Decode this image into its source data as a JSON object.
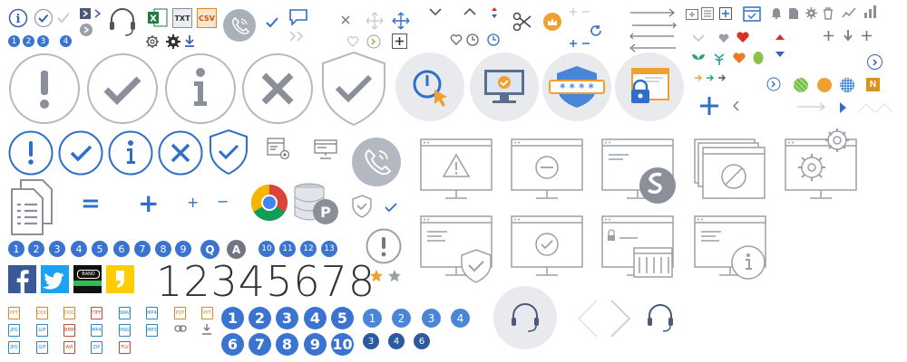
{
  "colors": {
    "blue": "#2f6fc9",
    "blue_dark": "#3a5fb0",
    "gray": "#9aa0aa",
    "gray_light": "#c6cbd3",
    "orange": "#f0a030",
    "red": "#d93025",
    "green": "#2aa46a"
  },
  "small_badges": [
    "1",
    "2",
    "3",
    "4"
  ],
  "number_badges": [
    "1",
    "2",
    "3",
    "4",
    "5",
    "6",
    "7",
    "8",
    "9"
  ],
  "letter_badges": [
    "Q",
    "A"
  ],
  "number_badges_2": [
    "10",
    "11",
    "12",
    "13"
  ],
  "big_digits": "12345678",
  "blue_large_row1": [
    "1",
    "2",
    "3",
    "4",
    "5"
  ],
  "blue_large_row2": [
    "6",
    "7",
    "8",
    "9",
    "10"
  ],
  "blue_small_row1": [
    "1",
    "2",
    "3",
    "4"
  ],
  "blue_small_row2": [
    "3",
    "4",
    "6"
  ],
  "file_labels": [
    "PPT",
    "DOC",
    "DOC",
    "TIFF",
    "WAV",
    "MP4",
    "PDF",
    "PPT",
    "JPG",
    "GIF",
    "BMP",
    "MP4",
    "PNG",
    "MP3",
    "JPG",
    "GIF",
    "AVI",
    "ZIP",
    "FLV"
  ],
  "band_label": "BAND",
  "misc": {
    "excel_label": "X",
    "txt_label": "TXT",
    "csv_label": "CSV",
    "password_mask": "* * * *",
    "equals_sign": "=",
    "plus_sign": "+",
    "minus_sign": "−",
    "n_label": "N"
  }
}
